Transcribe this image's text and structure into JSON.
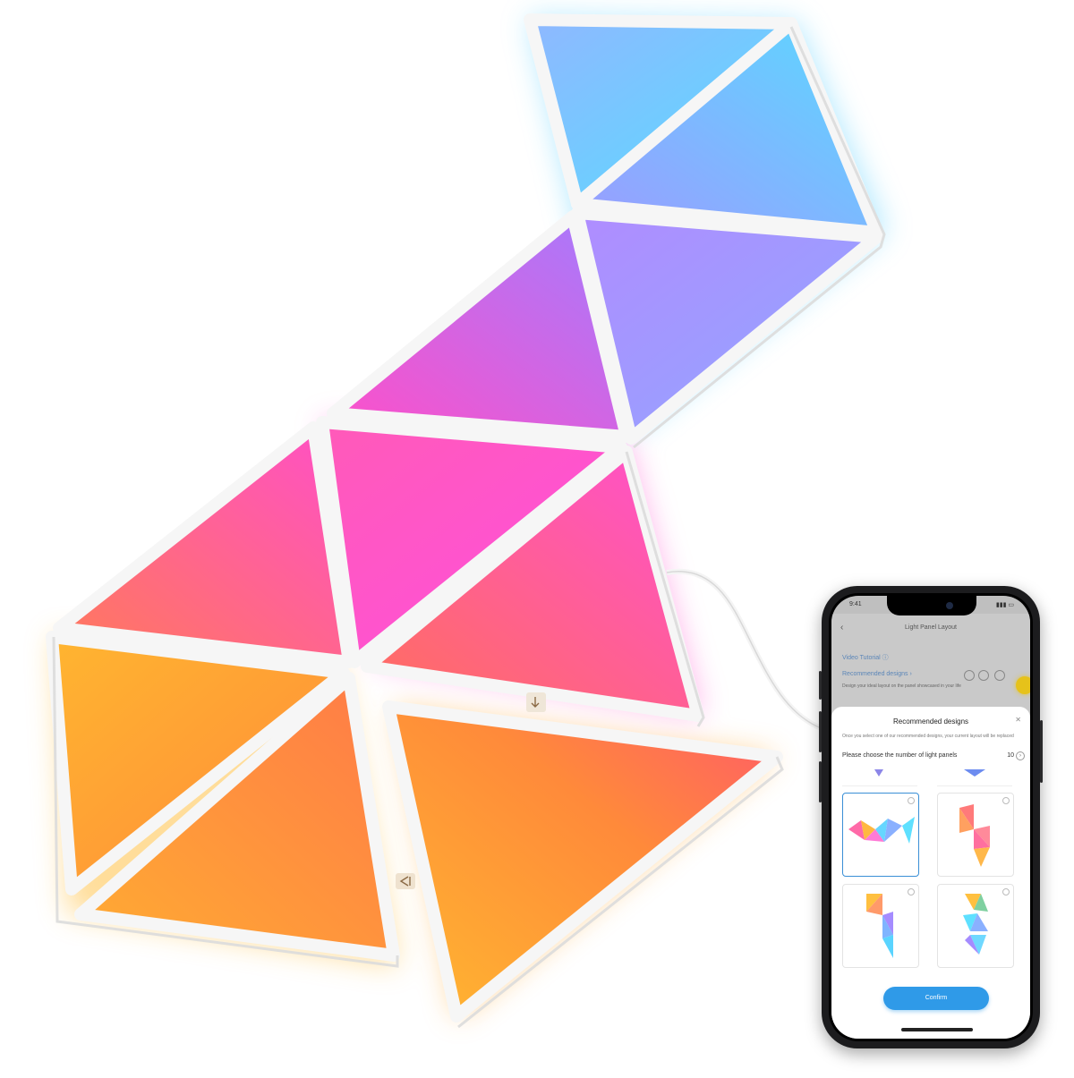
{
  "panels": {
    "colors": {
      "cyan": "#5fd7ff",
      "blue": "#7a9cff",
      "violet": "#b37cf2",
      "magenta": "#ff4fd4",
      "pink": "#ff5aa8",
      "coral": "#ff6f6a",
      "orange": "#ff8a3a",
      "amber": "#ffb230",
      "yellow": "#ffc933"
    },
    "frame_color": "#f4f4f4",
    "connector_icon_top": "touch-icon",
    "connector_icon_bottom": "arrow-icon"
  },
  "phone": {
    "nav_title": "Light Panel Layout",
    "video_tutorial_link": "Video Tutorial ⓘ",
    "recommended_designs_link": "Recommended designs ›",
    "recommended_hint": "Design your ideal layout on the panel showcased in your life",
    "toolbar_icons": [
      "undo-icon",
      "redo-icon",
      "settings-icon"
    ],
    "modal": {
      "title": "Recommended designs",
      "description": "Once you select one of our recommended designs, your current layout will be replaced",
      "count_label": "Please choose the number of light panels",
      "count_value": "10",
      "confirm_label": "Confirm",
      "designs": [
        "wave-design",
        "s-shape-design",
        "hook-design",
        "zigzag-design"
      ],
      "selected_design": "wave-design"
    },
    "accent": "#2f9ae8"
  }
}
